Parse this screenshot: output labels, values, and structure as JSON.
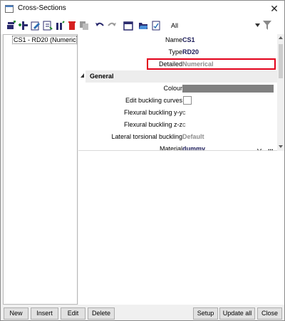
{
  "window": {
    "title": "Cross-Sections",
    "close_glyph": "✕"
  },
  "toolbar": {
    "buttons": [
      "new-icon",
      "insert-icon",
      "edit-icon",
      "import-icon",
      "delete-icon",
      "copy-icon",
      "undo-icon",
      "redo-icon",
      "print-icon",
      "open-folder-icon",
      "check-icon"
    ],
    "filter_value": "All"
  },
  "list": {
    "items": [
      "CS1 - RD20 (Numerical)"
    ]
  },
  "properties": {
    "name_label": "Name",
    "name_value": "CS1",
    "type_label": "Type",
    "type_value": "RD20",
    "detailed_label": "Detailed",
    "detailed_value": "Numerical",
    "section_title": "General",
    "colour_label": "Colour",
    "colour_value": "#808080",
    "edit_buckling_label": "Edit buckling curves",
    "flex_yy_label": "Flexural buckling y-y",
    "flex_yy_value": "c",
    "flex_zz_label": "Flexural buckling z-z",
    "flex_zz_value": "c",
    "lat_tors_label": "Lateral torsional buckling",
    "lat_tors_value": "Default",
    "material_label": "Material",
    "material_value": "dummy",
    "material_more": "..."
  },
  "buttons": {
    "new": "New",
    "insert": "Insert",
    "edit": "Edit",
    "delete": "Delete",
    "setup": "Setup",
    "update_all": "Update all",
    "close": "Close"
  },
  "colors": {
    "highlight": "#e2001a",
    "value_text": "#1d1d5a"
  }
}
